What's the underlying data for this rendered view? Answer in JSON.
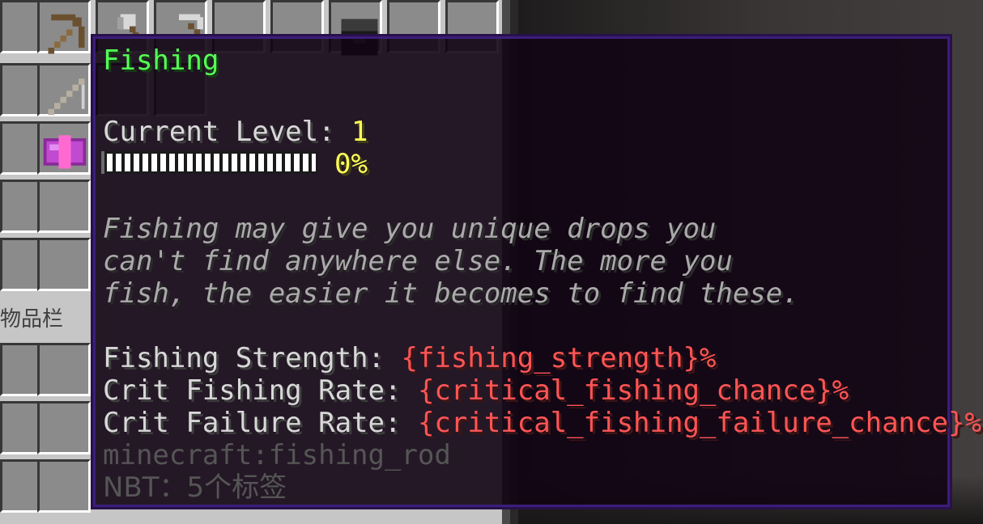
{
  "inventory": {
    "label": "物品栏"
  },
  "items": [
    {
      "name": "wooden-pickaxe-icon"
    },
    {
      "name": "iron-axe-icon"
    },
    {
      "name": "iron-pickaxe-icon"
    },
    {
      "name": "dark-block-icon"
    },
    {
      "name": "fishing-rod-icon"
    },
    {
      "name": "enchanted-book-icon"
    }
  ],
  "tooltip": {
    "title": "Fishing",
    "level_label": "Current Level: ",
    "level_value": "1",
    "progress_text": "0%",
    "progress_fraction": 0,
    "description": [
      "Fishing may give you unique drops you",
      "can't find anywhere else. The more you",
      "fish, the easier it becomes to find these."
    ],
    "stats": [
      {
        "label": "Fishing Strength: ",
        "value": "{fishing_strength}%"
      },
      {
        "label": "Crit Fishing Rate: ",
        "value": "{critical_fishing_chance}%"
      },
      {
        "label": "Crit Failure Rate: ",
        "value": "{critical_fishing_failure_chance}%"
      }
    ],
    "item_id": "minecraft:fishing_rod",
    "nbt": "NBT：5个标签"
  },
  "colors": {
    "title": "#55ff55",
    "level": "#ffff55",
    "stat_value": "#ff5555",
    "meta": "#555555"
  }
}
